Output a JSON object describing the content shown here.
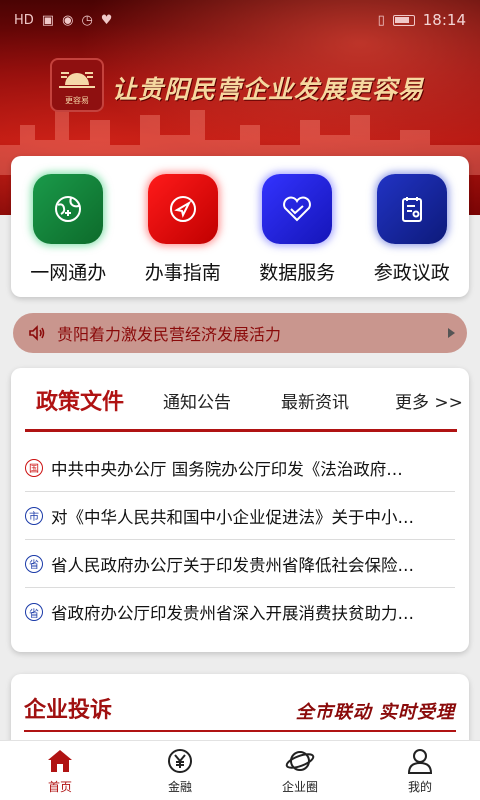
{
  "status_bar": {
    "time": "18:14"
  },
  "banner": {
    "slogan": "让贵阳民营企业发展更容易",
    "logo_text": "更容易"
  },
  "menu": [
    {
      "label": "一网通办",
      "icon": "globe-refresh-icon",
      "color": "#12803a"
    },
    {
      "label": "办事指南",
      "icon": "navigation-arrow-icon",
      "color": "#e30d0d"
    },
    {
      "label": "数据服务",
      "icon": "heart-handshake-icon",
      "color": "#2424e0"
    },
    {
      "label": "参政议政",
      "icon": "document-person-icon",
      "color": "#16229b"
    }
  ],
  "notice": {
    "text": "贵阳着力激发民营经济发展活力",
    "icon": "speaker-icon"
  },
  "news": {
    "tabs": [
      {
        "label": "政策文件",
        "active": true
      },
      {
        "label": "通知公告"
      },
      {
        "label": "最新资讯"
      },
      {
        "label": "更多 >>"
      }
    ],
    "items": [
      {
        "badge": "国",
        "title": "中共中央办公厅 国务院办公厅印发《法治政府…"
      },
      {
        "badge": "市",
        "title": "对《中华人民共和国中小企业促进法》关于中小…"
      },
      {
        "badge": "省",
        "title": "省人民政府办公厅关于印发贵州省降低社会保险…"
      },
      {
        "badge": "省",
        "title": "省政府办公厅印发贵州省深入开展消费扶贫助力…"
      }
    ]
  },
  "complaint": {
    "title": "企业投诉",
    "slogan": "全市联动 实时受理"
  },
  "bottom_nav": [
    {
      "label": "首页",
      "icon": "home-icon",
      "active": true
    },
    {
      "label": "金融",
      "icon": "yuan-coin-icon"
    },
    {
      "label": "企业圈",
      "icon": "planet-icon"
    },
    {
      "label": "我的",
      "icon": "user-icon"
    }
  ],
  "colors": {
    "brand_red": "#b01313",
    "notice_bg": "#c9968e"
  }
}
